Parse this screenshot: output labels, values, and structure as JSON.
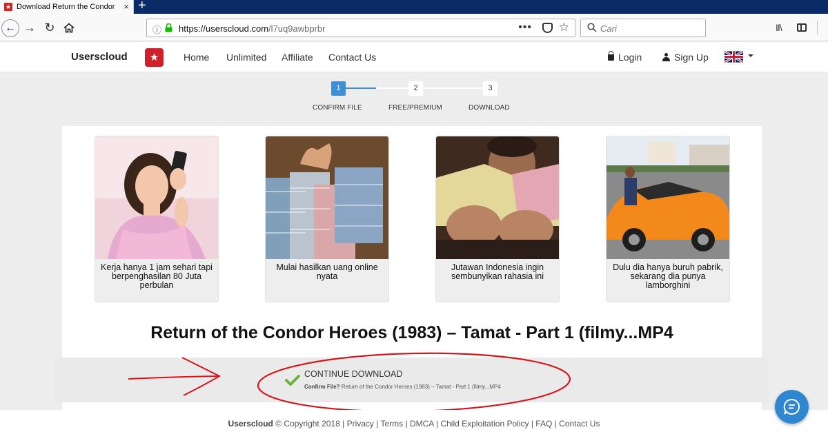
{
  "browser": {
    "tab_title": "Download Return the Condor Heroes",
    "tab_close": "×",
    "new_tab": "+",
    "url_host": "https://userscloud.com",
    "url_path": "/l7uq9awbprbr",
    "search_placeholder": "Cari",
    "more_glyph": "•••",
    "library_glyph": "II\\"
  },
  "site": {
    "brand": "Userscloud",
    "menu": [
      "Home",
      "Unlimited",
      "Affiliate",
      "Contact Us"
    ],
    "login": "Login",
    "signup": "Sign Up",
    "accent_color": "#3d8fd6",
    "logo_color": "#d0202a"
  },
  "steps": [
    {
      "number": "1",
      "label": "CONFIRM FILE",
      "active": true
    },
    {
      "number": "2",
      "label": "FREE/PREMIUM",
      "active": false
    },
    {
      "number": "3",
      "label": "DOWNLOAD",
      "active": false
    }
  ],
  "ads": [
    {
      "caption": "Kerja hanya 1 jam sehari tapi berpenghasilan 80 Juta perbulan"
    },
    {
      "caption": "Mulai hasilkan uang online nyata"
    },
    {
      "caption": "Jutawan Indonesia ingin sembunyikan rahasia ini"
    },
    {
      "caption": "Dulu dia hanya buruh pabrik, sekarang dia punya lamborghini"
    }
  ],
  "file_title": "Return of the Condor Heroes (1983) – Tamat - Part 1 (filmy...MP4",
  "download": {
    "button_label": "CONTINUE DOWNLOAD",
    "confirm_label": "Confirm File?",
    "confirm_name": "Return of the Condor Heroes (1983) – Tamat - Part 1 (filmy...MP4"
  },
  "footer": {
    "brand": "Userscloud",
    "copyright": "© Copyright 2018 |",
    "links": [
      "Privacy",
      "Terms",
      "DMCA",
      "Child Exploitation Policy",
      "FAQ",
      "Contact Us"
    ]
  }
}
